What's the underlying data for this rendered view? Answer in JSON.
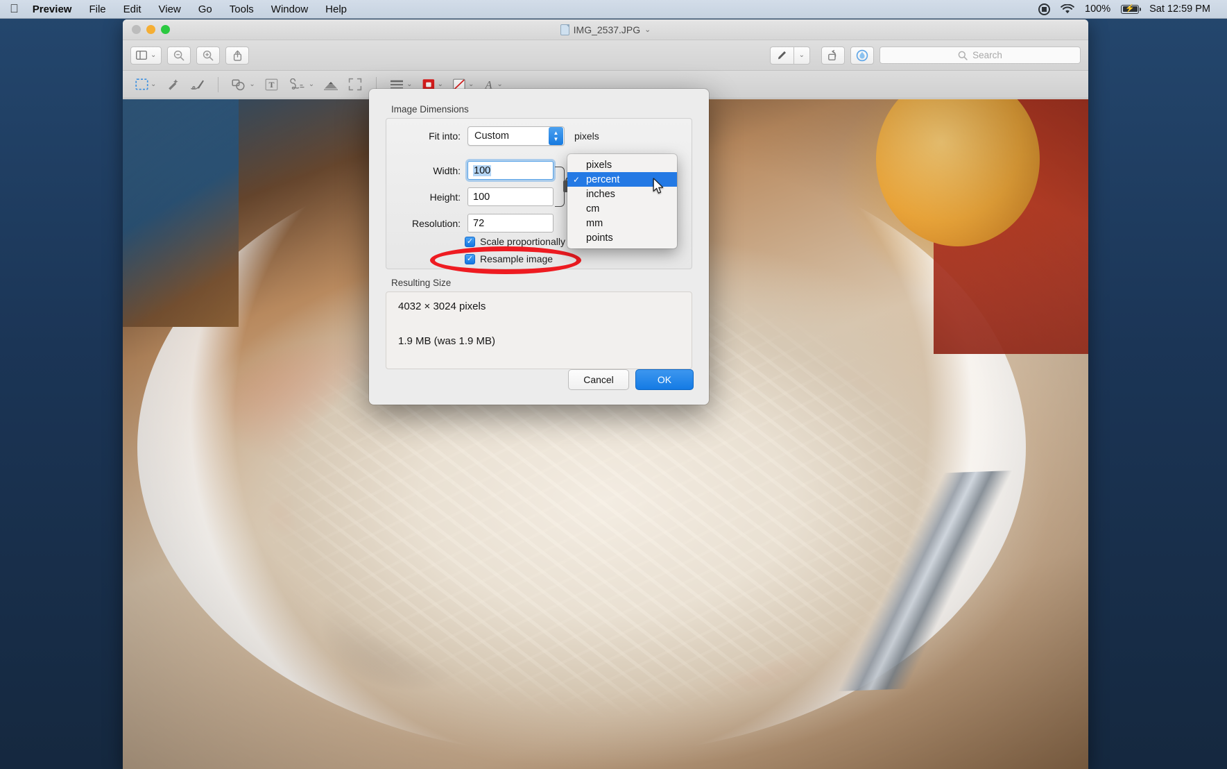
{
  "menubar": {
    "apple_icon": "apple-logo",
    "items": [
      {
        "label": "Preview",
        "bold": true
      },
      {
        "label": "File"
      },
      {
        "label": "Edit"
      },
      {
        "label": "View"
      },
      {
        "label": "Go"
      },
      {
        "label": "Tools"
      },
      {
        "label": "Window"
      },
      {
        "label": "Help"
      }
    ],
    "status": {
      "screen_recording_icon": "record-icon",
      "wifi_icon": "wifi-icon",
      "battery_percent": "100%",
      "battery_icon": "battery-charging-icon",
      "clock": "Sat 12:59 PM"
    }
  },
  "window": {
    "title": "IMG_2537.JPG",
    "title_icon": "document-icon",
    "title_chevron": "⌄",
    "traffic_lights": [
      "close-button",
      "minimize-button",
      "maximize-button"
    ],
    "toolbar": {
      "sidebar_button": "sidebar-icon",
      "sidebar_chevron": "⌄",
      "zoom_out": "zoom-out-icon",
      "zoom_in": "zoom-in-icon",
      "share": "share-icon",
      "markup": "markup-pen-icon",
      "markup_chevron": "⌄",
      "rotate": "rotate-icon",
      "annotate": "annotate-icon",
      "search_placeholder": "Search",
      "search_value": ""
    },
    "markup_toolbar": [
      {
        "name": "selection-tool",
        "icon": "rect-select-icon",
        "chevron": "⌄",
        "active": true
      },
      {
        "name": "instant-alpha-tool",
        "icon": "magic-wand-icon"
      },
      {
        "name": "sketch-tool",
        "icon": "sketch-icon"
      },
      {
        "name": "shapes-tool",
        "icon": "shapes-icon",
        "chevron": "⌄"
      },
      {
        "name": "text-tool",
        "icon": "text-box-icon"
      },
      {
        "name": "signature-tool",
        "icon": "signature-icon",
        "chevron": "⌄"
      },
      {
        "name": "adjust-color-tool",
        "icon": "adjust-color-icon"
      },
      {
        "name": "adjust-size-tool",
        "icon": "adjust-size-icon"
      },
      {
        "name": "shape-style-tool",
        "icon": "shape-style-icon",
        "chevron": "⌄"
      },
      {
        "name": "border-color-tool",
        "icon": "border-color-icon",
        "chevron": "⌄"
      },
      {
        "name": "fill-color-tool",
        "icon": "fill-color-icon",
        "chevron": "⌄"
      },
      {
        "name": "font-style-tool",
        "icon": "font-icon",
        "chevron": "⌄"
      }
    ]
  },
  "dialog": {
    "image_dimensions_label": "Image Dimensions",
    "fit_into_label": "Fit into:",
    "fit_into_value": "Custom",
    "unit_suffix_label": "pixels",
    "width_label": "Width:",
    "width_value": "100",
    "height_label": "Height:",
    "height_value": "100",
    "resolution_label": "Resolution:",
    "resolution_value": "72",
    "scale_proportionally_label": "Scale proportionally",
    "scale_proportionally_checked": true,
    "resample_image_label": "Resample image",
    "resample_image_checked": true,
    "resulting_size_label": "Resulting Size",
    "resulting_dimensions": "4032 × 3024 pixels",
    "resulting_filesize": "1.9 MB (was 1.9 MB)",
    "cancel_label": "Cancel",
    "ok_label": "OK",
    "link_lock_icon": "link-lock-icon"
  },
  "unit_dropdown": {
    "selected": "percent",
    "check_glyph": "✓",
    "items": [
      {
        "label": "pixels",
        "checked": false
      },
      {
        "label": "percent",
        "checked": true
      },
      {
        "label": "inches",
        "checked": false
      },
      {
        "label": "cm",
        "checked": false
      },
      {
        "label": "mm",
        "checked": false
      },
      {
        "label": "points",
        "checked": false
      }
    ]
  },
  "annotation": {
    "shape": "red-ellipse-highlight",
    "color": "#ee1b21",
    "targets_label": "Resample image"
  },
  "cursor": {
    "icon": "arrow-pointer"
  },
  "colors": {
    "accent_blue": "#147ae4",
    "annotation_red": "#ee1b21",
    "menubar_bg": "#cdd8e5",
    "dialog_bg": "#ececec"
  }
}
